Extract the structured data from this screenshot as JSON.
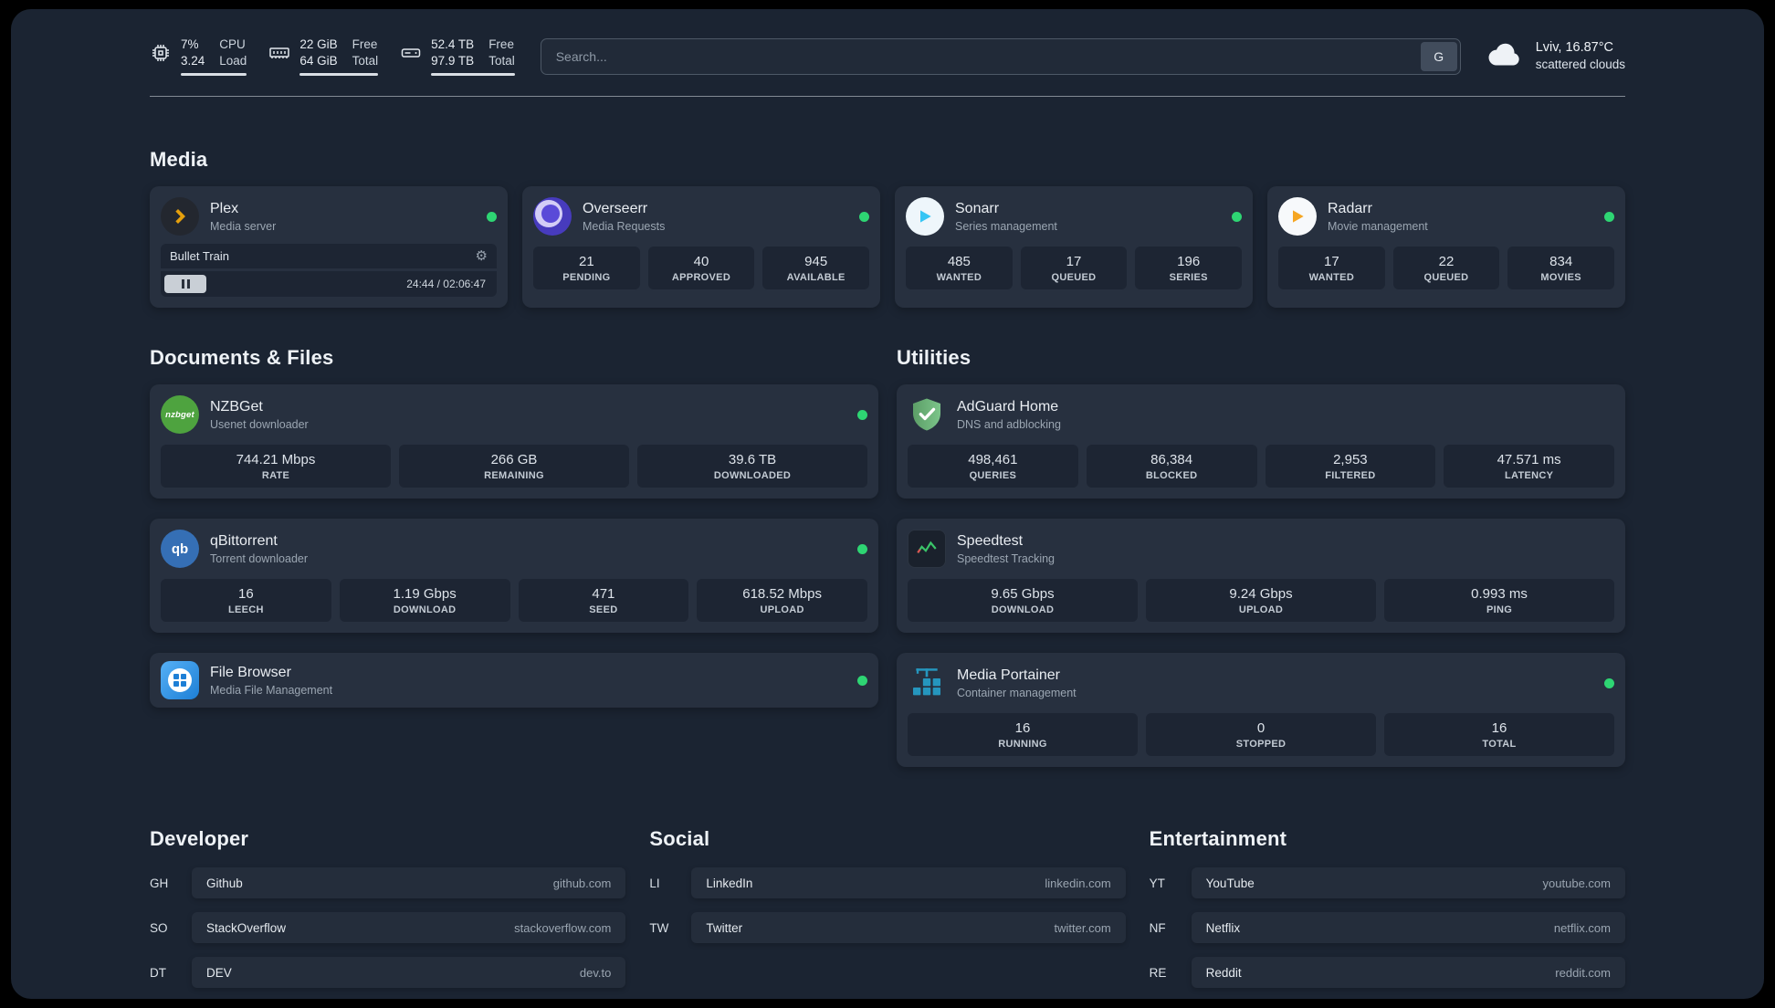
{
  "colors": {
    "status-online": "#2ed573",
    "plex": "#e5a00d",
    "overseerr": "#5a4ad8",
    "sonarr": "#35c5f4",
    "radarr": "#f5a623",
    "nzbget": "#4ea33f",
    "qbittorrent": "#356fb5",
    "filebrowser": "#1d7fd6",
    "adguard": "#68b47b",
    "speedtest": "#3ac569",
    "portainer": "#2596be"
  },
  "icon_text": {
    "nzbget": "nzbget",
    "qbittorrent": "qb"
  },
  "topbar": {
    "cpu": {
      "values": [
        "7%",
        "3.24"
      ],
      "labels": [
        "CPU",
        "Load"
      ]
    },
    "memory": {
      "values": [
        "22 GiB",
        "64 GiB"
      ],
      "labels": [
        "Free",
        "Total"
      ]
    },
    "disk": {
      "values": [
        "52.4 TB",
        "97.9 TB"
      ],
      "labels": [
        "Free",
        "Total"
      ]
    },
    "search": {
      "placeholder": "Search...",
      "button": "G"
    },
    "weather": {
      "location": "Lviv, 16.87°C",
      "condition": "scattered clouds"
    }
  },
  "media": {
    "title": "Media",
    "cards": [
      {
        "name": "Plex",
        "subtitle": "Media server",
        "status": "online",
        "player": {
          "track": "Bullet Train",
          "time": "24:44 / 02:06:47"
        }
      },
      {
        "name": "Overseerr",
        "subtitle": "Media Requests",
        "status": "online",
        "stats": [
          {
            "value": "21",
            "label": "PENDING"
          },
          {
            "value": "40",
            "label": "APPROVED"
          },
          {
            "value": "945",
            "label": "AVAILABLE"
          }
        ]
      },
      {
        "name": "Sonarr",
        "subtitle": "Series management",
        "status": "online",
        "stats": [
          {
            "value": "485",
            "label": "WANTED"
          },
          {
            "value": "17",
            "label": "QUEUED"
          },
          {
            "value": "196",
            "label": "SERIES"
          }
        ]
      },
      {
        "name": "Radarr",
        "subtitle": "Movie management",
        "status": "online",
        "stats": [
          {
            "value": "17",
            "label": "WANTED"
          },
          {
            "value": "22",
            "label": "QUEUED"
          },
          {
            "value": "834",
            "label": "MOVIES"
          }
        ]
      }
    ]
  },
  "documents": {
    "title": "Documents & Files",
    "cards": [
      {
        "name": "NZBGet",
        "subtitle": "Usenet downloader",
        "status": "online",
        "stats": [
          {
            "value": "744.21 Mbps",
            "label": "RATE"
          },
          {
            "value": "266 GB",
            "label": "REMAINING"
          },
          {
            "value": "39.6 TB",
            "label": "DOWNLOADED"
          }
        ]
      },
      {
        "name": "qBittorrent",
        "subtitle": "Torrent downloader",
        "status": "online",
        "stats": [
          {
            "value": "16",
            "label": "LEECH"
          },
          {
            "value": "1.19 Gbps",
            "label": "DOWNLOAD"
          },
          {
            "value": "471",
            "label": "SEED"
          },
          {
            "value": "618.52 Mbps",
            "label": "UPLOAD"
          }
        ]
      },
      {
        "name": "File Browser",
        "subtitle": "Media File Management",
        "status": "online"
      }
    ]
  },
  "utilities": {
    "title": "Utilities",
    "cards": [
      {
        "name": "AdGuard Home",
        "subtitle": "DNS and adblocking",
        "stats": [
          {
            "value": "498,461",
            "label": "QUERIES"
          },
          {
            "value": "86,384",
            "label": "BLOCKED"
          },
          {
            "value": "2,953",
            "label": "FILTERED"
          },
          {
            "value": "47.571 ms",
            "label": "LATENCY"
          }
        ]
      },
      {
        "name": "Speedtest",
        "subtitle": "Speedtest Tracking",
        "stats": [
          {
            "value": "9.65 Gbps",
            "label": "DOWNLOAD"
          },
          {
            "value": "9.24 Gbps",
            "label": "UPLOAD"
          },
          {
            "value": "0.993 ms",
            "label": "PING"
          }
        ]
      },
      {
        "name": "Media Portainer",
        "subtitle": "Container management",
        "status": "online",
        "stats": [
          {
            "value": "16",
            "label": "RUNNING"
          },
          {
            "value": "0",
            "label": "STOPPED"
          },
          {
            "value": "16",
            "label": "TOTAL"
          }
        ]
      }
    ]
  },
  "bookmarks": {
    "groups": [
      {
        "title": "Developer",
        "items": [
          {
            "abbr": "GH",
            "name": "Github",
            "url": "github.com"
          },
          {
            "abbr": "SO",
            "name": "StackOverflow",
            "url": "stackoverflow.com"
          },
          {
            "abbr": "DT",
            "name": "DEV",
            "url": "dev.to"
          }
        ]
      },
      {
        "title": "Social",
        "items": [
          {
            "abbr": "LI",
            "name": "LinkedIn",
            "url": "linkedin.com"
          },
          {
            "abbr": "TW",
            "name": "Twitter",
            "url": "twitter.com"
          }
        ]
      },
      {
        "title": "Entertainment",
        "items": [
          {
            "abbr": "YT",
            "name": "YouTube",
            "url": "youtube.com"
          },
          {
            "abbr": "NF",
            "name": "Netflix",
            "url": "netflix.com"
          },
          {
            "abbr": "RE",
            "name": "Reddit",
            "url": "reddit.com"
          }
        ]
      }
    ]
  }
}
